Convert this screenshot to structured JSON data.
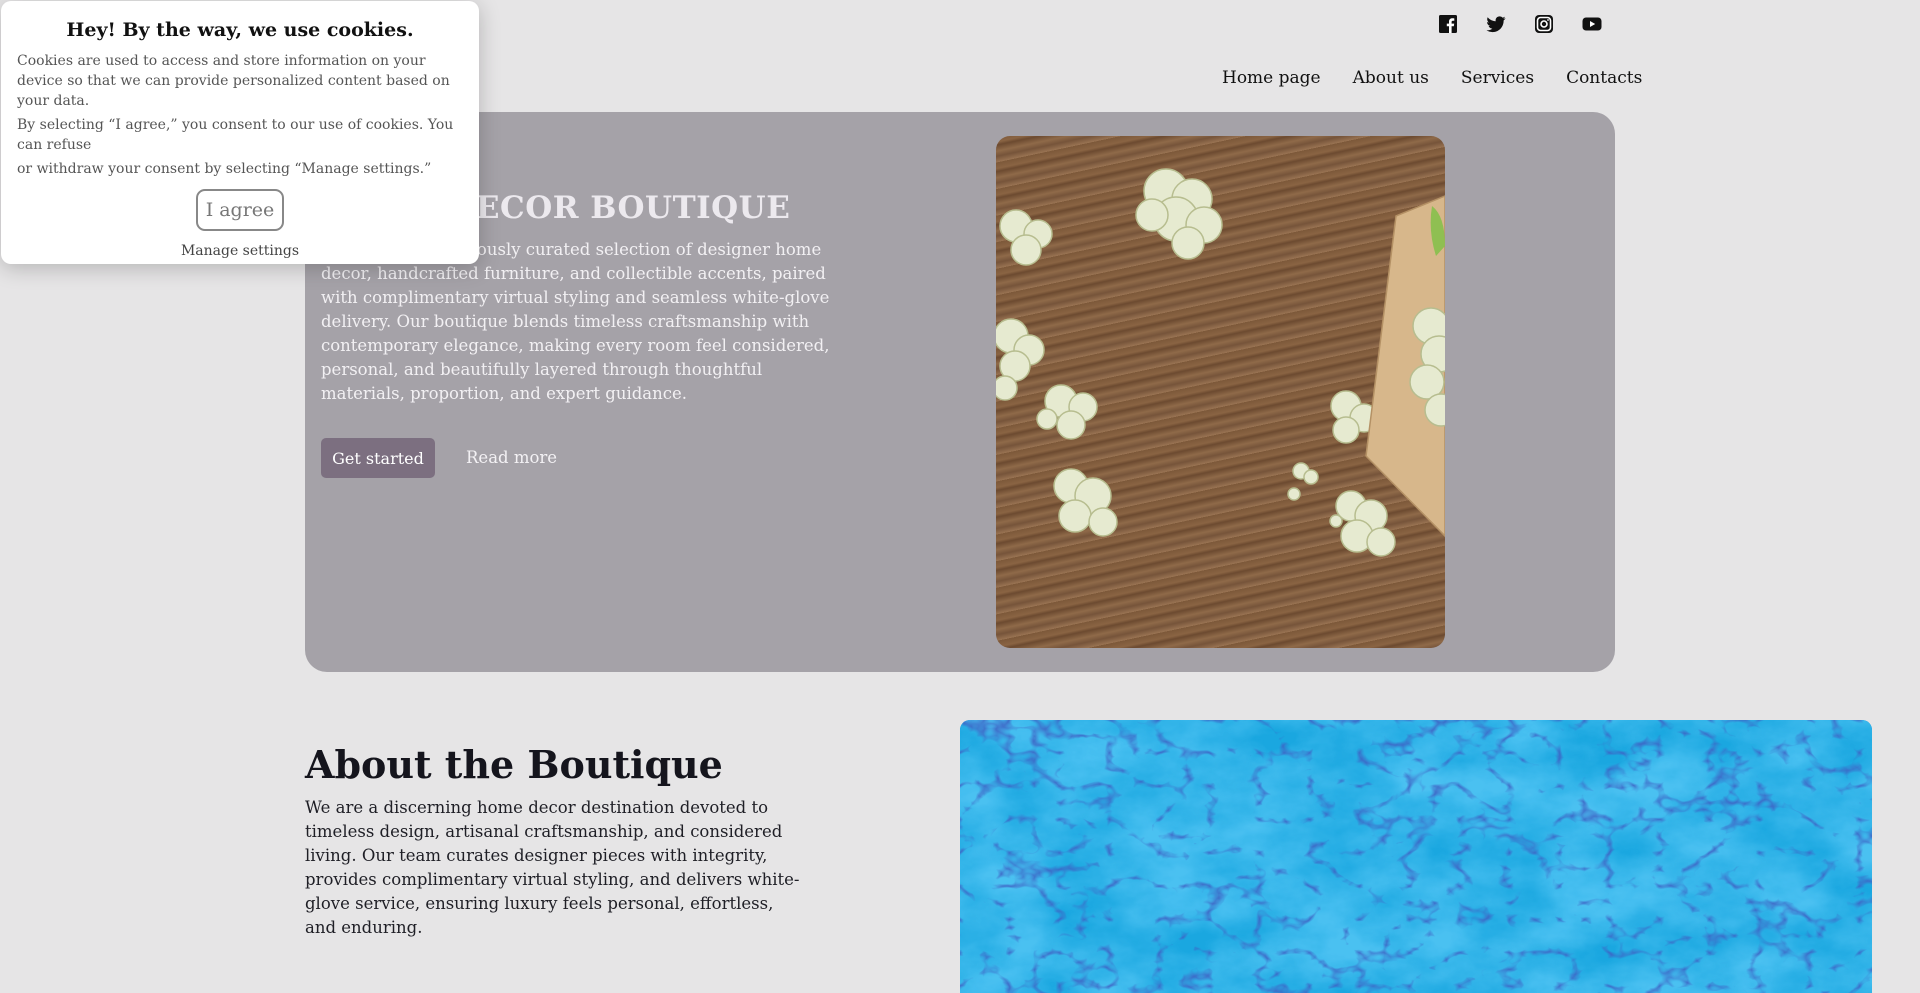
{
  "header": {
    "social": [
      {
        "name": "facebook-icon"
      },
      {
        "name": "twitter-icon"
      },
      {
        "name": "instagram-icon"
      },
      {
        "name": "youtube-icon"
      }
    ],
    "nav": [
      "Home page",
      "About us",
      "Services",
      "Contacts"
    ]
  },
  "hero": {
    "title": "HOME DECOR BOUTIQUE",
    "text": "Discover a meticulously curated selection of designer home decor, handcrafted furniture, and collectible accents, paired with complimentary virtual styling and seamless white-glove delivery. Our boutique blends timeless craftsmanship with contemporary elegance, making every room feel considered, personal, and beautifully layered through thoughtful materials, proportion, and expert guidance.",
    "primary_button": "Get started",
    "secondary_link": "Read more",
    "background_color": "#a5a2a8",
    "button_color": "#7c6f80"
  },
  "about": {
    "title": "About the Boutique",
    "text": "We are a discerning home decor destination devoted to timeless design, artisanal craftsmanship, and considered living. Our team curates designer pieces with integrity, provides complimentary virtual styling, and delivers white-glove service, ensuring luxury feels personal, effortless, and enduring."
  },
  "cookie": {
    "title": "Hey! By the way, we use cookies.",
    "p1": "Cookies are used to access and store information on your device so that we can provide personalized content based on your data.",
    "p2": "By selecting “I agree,” you consent to our use of cookies. You can refuse",
    "p3": "or withdraw your consent by selecting “Manage settings.”",
    "agree": "I agree",
    "manage": "Manage settings"
  }
}
